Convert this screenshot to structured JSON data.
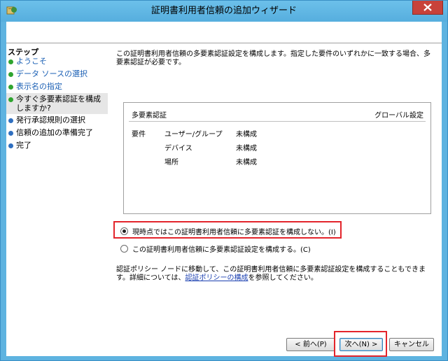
{
  "window": {
    "title": "証明書利用者信頼の追加ウィザード"
  },
  "steps": {
    "title": "ステップ",
    "items": [
      {
        "label": "ようこそ",
        "state": "done"
      },
      {
        "label": "データ ソースの選択",
        "state": "done"
      },
      {
        "label": "表示名の指定",
        "state": "done"
      },
      {
        "label": "今すぐ多要素認証を構成しますか?",
        "state": "current"
      },
      {
        "label": "発行承認規則の選択",
        "state": "future"
      },
      {
        "label": "信頼の追加の準備完了",
        "state": "future"
      },
      {
        "label": "完了",
        "state": "future"
      }
    ]
  },
  "main": {
    "intro": "この証明書利用者信頼の多要素認証設定を構成します。指定した要件のいずれかに一致する場合、多要素認証が必要です。",
    "mfa": {
      "heading": "多要素認証",
      "global_setting": "グローバル設定",
      "requirements_label": "要件",
      "rows": [
        {
          "name": "ユーザー/グループ",
          "value": "未構成"
        },
        {
          "name": "デバイス",
          "value": "未構成"
        },
        {
          "name": "場所",
          "value": "未構成"
        }
      ]
    },
    "radio_no_configure": "現時点ではこの証明書利用者信頼に多要素認証を構成しない。(I)",
    "radio_configure": "この証明書利用者信頼に多要素認証設定を構成する。(C)",
    "policy_note_pre": "認証ポリシー ノードに移動して、この証明書利用者信頼に多要素認証設定を構成することもできます。詳細については、",
    "policy_link": "認証ポリシーの構成",
    "policy_note_post": "を参照してください。"
  },
  "buttons": {
    "back": "< 前へ(P)",
    "next": "次へ(N) >",
    "cancel": "キャンセル"
  },
  "colors": {
    "highlight": "#e3242b",
    "title_bar": "#5eb3e0",
    "done_dot": "#2fa52f",
    "future_dot": "#2f6fc0"
  }
}
